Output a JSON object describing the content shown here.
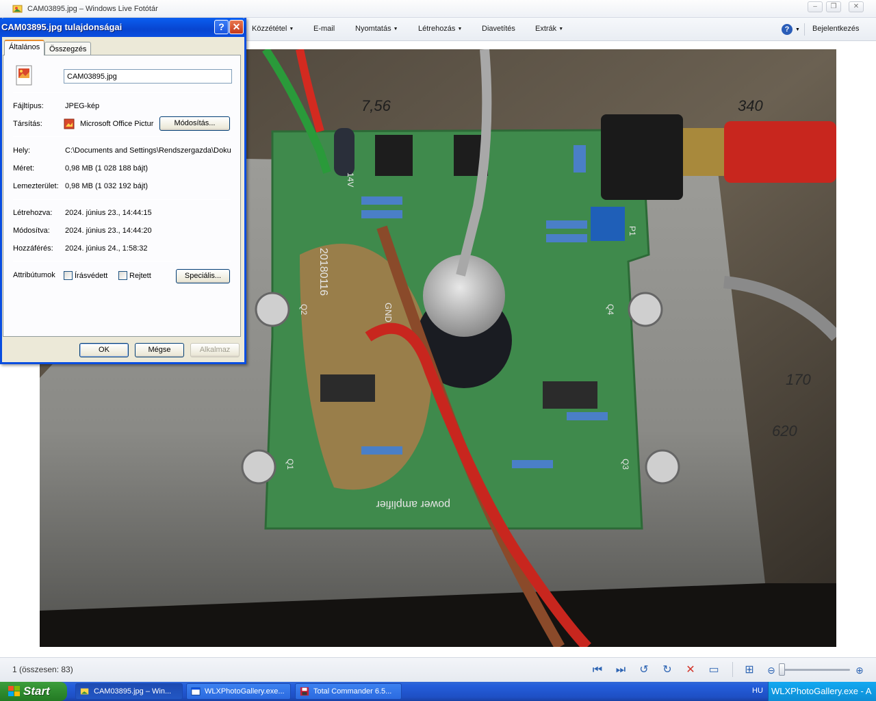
{
  "app": {
    "title": "CAM03895.jpg – Windows Live Fotótár",
    "icon": "photo-gallery-icon"
  },
  "menubar": {
    "items": [
      {
        "label": "Közzététel",
        "has_caret": true
      },
      {
        "label": "E-mail",
        "has_caret": false
      },
      {
        "label": "Nyomtatás",
        "has_caret": true
      },
      {
        "label": "Létrehozás",
        "has_caret": true
      },
      {
        "label": "Diavetítés",
        "has_caret": false
      },
      {
        "label": "Extrák",
        "has_caret": true
      }
    ],
    "help_glyph": "?",
    "signin_label": "Bejelentkezés"
  },
  "photo": {
    "pcb_labels": {
      "date": "20180116",
      "product": "power amplifier",
      "voltage": "14V",
      "gnd": "GND",
      "chalk_top_left": "7,56",
      "chalk_top_right": "340",
      "chalk_right_1": "170",
      "chalk_right_2": "620",
      "q1": "Q1",
      "q2": "Q2",
      "q3": "Q3",
      "q4": "Q4",
      "p1": "P1"
    }
  },
  "status": {
    "text": "1 (összesen: 83)"
  },
  "toolbar": {
    "icons": [
      "previous-icon",
      "next-icon",
      "rotate-left-icon",
      "rotate-right-icon",
      "delete-icon",
      "slideshow-icon",
      "fit-icon",
      "zoom-out-icon",
      "zoom-in-icon"
    ]
  },
  "dialog": {
    "title": "CAM03895.jpg tulajdonságai",
    "help_glyph": "?",
    "close_glyph": "✕",
    "tabs": [
      "Általános",
      "Összegzés"
    ],
    "filename": "CAM03895.jpg",
    "rows": {
      "type_label": "Fájltípus:",
      "type_value": "JPEG-kép",
      "assoc_label": "Társítás:",
      "assoc_value": "Microsoft Office Pictur",
      "assoc_button": "Módosítás...",
      "location_label": "Hely:",
      "location_value": "C:\\Documents and Settings\\Rendszergazda\\Dokur",
      "size_label": "Méret:",
      "size_value": "0,98 MB (1 028 188 bájt)",
      "disk_label": "Lemezterület:",
      "disk_value": "0,98 MB (1 032 192 bájt)",
      "created_label": "Létrehozva:",
      "created_value": "2024. június 23., 14:44:15",
      "modified_label": "Módosítva:",
      "modified_value": "2024. június 23., 14:44:20",
      "accessed_label": "Hozzáférés:",
      "accessed_value": "2024. június 24., 1:58:32",
      "attr_label": "Attribútumok",
      "readonly_label": "Írásvédett",
      "hidden_label": "Rejtett",
      "advanced_button": "Speciális..."
    },
    "ok": "OK",
    "cancel": "Mégse",
    "apply": "Alkalmaz"
  },
  "taskbar": {
    "start": "Start",
    "tasks": [
      {
        "label": "CAM03895.jpg – Win...",
        "icon": "photo-gallery-icon"
      },
      {
        "label": "WLXPhotoGallery.exe...",
        "icon": "window-icon"
      },
      {
        "label": "Total Commander 6.5...",
        "icon": "floppy-icon"
      }
    ],
    "lang": "HU",
    "tray_task": "WLXPhotoGallery.exe - A"
  },
  "colors": {
    "xp_blue": "#0a4ee0",
    "start_green": "#2f8b2f",
    "pcb_green": "#3f8a4c",
    "wire_red": "#c8261e"
  }
}
